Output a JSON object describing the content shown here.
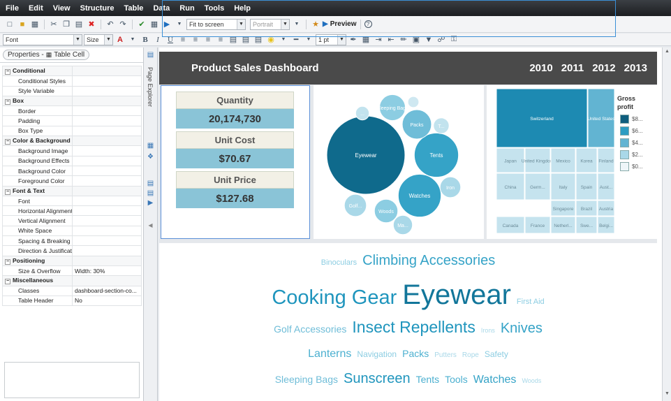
{
  "menu": [
    "File",
    "Edit",
    "View",
    "Structure",
    "Table",
    "Data",
    "Run",
    "Tools",
    "Help"
  ],
  "toolbar": {
    "zoom_value": "Fit to screen",
    "orientation_value": "Portrait",
    "preview_label": "Preview"
  },
  "format_bar": {
    "font_value": "Font",
    "size_value": "Size",
    "line_width_value": "1 pt"
  },
  "properties_panel": {
    "title": "Properties - ",
    "context": "Table Cell",
    "groups": [
      {
        "name": "Conditional",
        "rows": [
          {
            "name": "Conditional Styles",
            "value": ""
          },
          {
            "name": "Style Variable",
            "value": ""
          }
        ]
      },
      {
        "name": "Box",
        "rows": [
          {
            "name": "Border",
            "value": ""
          },
          {
            "name": "Padding",
            "value": ""
          },
          {
            "name": "Box Type",
            "value": ""
          }
        ]
      },
      {
        "name": "Color & Background",
        "rows": [
          {
            "name": "Background Image",
            "value": ""
          },
          {
            "name": "Background Effects",
            "value": ""
          },
          {
            "name": "Background Color",
            "value": ""
          },
          {
            "name": "Foreground Color",
            "value": ""
          }
        ]
      },
      {
        "name": "Font & Text",
        "rows": [
          {
            "name": "Font",
            "value": ""
          },
          {
            "name": "Horizontal Alignment",
            "value": ""
          },
          {
            "name": "Vertical Alignment",
            "value": ""
          },
          {
            "name": "White Space",
            "value": ""
          },
          {
            "name": "Spacing & Breaking",
            "value": ""
          },
          {
            "name": "Direction & Justification",
            "value": ""
          }
        ]
      },
      {
        "name": "Positioning",
        "rows": [
          {
            "name": "Size & Overflow",
            "value": "Width: 30%"
          }
        ]
      },
      {
        "name": "Miscellaneous",
        "rows": [
          {
            "name": "Classes",
            "value": "dashboard-section-co..."
          },
          {
            "name": "Table Header",
            "value": "No"
          }
        ]
      }
    ]
  },
  "side_strip": {
    "page_explorer_label": "Page Explorer"
  },
  "dashboard": {
    "title": "Product Sales Dashboard",
    "years": [
      "2010",
      "2011",
      "2012",
      "2013"
    ],
    "kpis": [
      {
        "label": "Quantity",
        "value": "20,174,730"
      },
      {
        "label": "Unit Cost",
        "value": "$70.67"
      },
      {
        "label": "Unit Price",
        "value": "$127.68"
      }
    ],
    "bubbles": [
      {
        "label": "Eyewear",
        "value": 100,
        "color": "#0f6a8c"
      },
      {
        "label": "Tents",
        "value": 32,
        "color": "#35a3c7"
      },
      {
        "label": "Watches",
        "value": 30,
        "color": "#35a3c7"
      },
      {
        "label": "Packs",
        "value": 14,
        "color": "#6fbdd8"
      },
      {
        "label": "Sleeping Bags",
        "value": 11,
        "color": "#8ccde2"
      },
      {
        "label": "Woods",
        "value": 9,
        "color": "#8ccde2"
      },
      {
        "label": "Golf...",
        "value": 8,
        "color": "#a9d8e8"
      },
      {
        "label": "Iron",
        "value": 7,
        "color": "#a9d8e8"
      },
      {
        "label": "Ma...",
        "value": 6,
        "color": "#a9d8e8"
      },
      {
        "label": "T...",
        "value": 4,
        "color": "#c2e3ee"
      },
      {
        "label": "...",
        "value": 3,
        "color": "#c2e3ee"
      },
      {
        "label": "...",
        "value": 2,
        "color": "#cfe8f1"
      }
    ],
    "treemap": {
      "legend_title": "Gross profit",
      "legend": [
        {
          "label": "$8...",
          "color": "#0f5e7e"
        },
        {
          "label": "$6...",
          "color": "#2c9cc2"
        },
        {
          "label": "$4...",
          "color": "#62b4d2"
        },
        {
          "label": "$2...",
          "color": "#a9d8e8"
        },
        {
          "label": "$0...",
          "color": "#eef6f9"
        }
      ],
      "cells": [
        {
          "label": "Switzerland",
          "color": "#1d8ab2"
        },
        {
          "label": "United States",
          "color": "#62b4d2"
        },
        {
          "label": "Japan",
          "color": "#c5e3ee"
        },
        {
          "label": "United Kingdom",
          "color": "#c5e3ee"
        },
        {
          "label": "Mexico",
          "color": "#c5e3ee"
        },
        {
          "label": "Korea",
          "color": "#c5e3ee"
        },
        {
          "label": "Finland",
          "color": "#c5e3ee"
        },
        {
          "label": "China",
          "color": "#c5e3ee"
        },
        {
          "label": "Germ...",
          "color": "#c5e3ee"
        },
        {
          "label": "Italy",
          "color": "#c5e3ee"
        },
        {
          "label": "Spain",
          "color": "#c5e3ee"
        },
        {
          "label": "Aust...",
          "color": "#c5e3ee"
        },
        {
          "label": "Singapore",
          "color": "#c5e3ee"
        },
        {
          "label": "Brazil",
          "color": "#c5e3ee"
        },
        {
          "label": "Austria",
          "color": "#c5e3ee"
        },
        {
          "label": "Canada",
          "color": "#c5e3ee"
        },
        {
          "label": "France",
          "color": "#c5e3ee"
        },
        {
          "label": "Netherl...",
          "color": "#c5e3ee"
        },
        {
          "label": "Swe...",
          "color": "#c5e3ee"
        },
        {
          "label": "Belgi...",
          "color": "#c5e3ee"
        }
      ]
    },
    "wordcloud": [
      [
        {
          "text": "Binoculars",
          "size": 11,
          "color": "#8ccde2"
        },
        {
          "text": "Climbing Accessories",
          "size": 20,
          "color": "#35a3c7"
        }
      ],
      [
        {
          "text": "Cooking Gear",
          "size": 29,
          "color": "#1f95bd"
        },
        {
          "text": "Eyewear",
          "size": 40,
          "color": "#12769a"
        },
        {
          "text": "First Aid",
          "size": 11,
          "color": "#8ccde2"
        }
      ],
      [
        {
          "text": "Golf Accessories",
          "size": 14,
          "color": "#6fbdd8"
        },
        {
          "text": "Insect Repellents",
          "size": 23,
          "color": "#1f95bd"
        },
        {
          "text": "Irons",
          "size": 9,
          "color": "#a9d8e8"
        },
        {
          "text": "Knives",
          "size": 20,
          "color": "#35a3c7"
        }
      ],
      [
        {
          "text": "Lanterns",
          "size": 16,
          "color": "#4cb0d0"
        },
        {
          "text": "Navigation",
          "size": 12,
          "color": "#8ccde2"
        },
        {
          "text": "Packs",
          "size": 14,
          "color": "#4cb0d0"
        },
        {
          "text": "Putters",
          "size": 10,
          "color": "#a9d8e8"
        },
        {
          "text": "Rope",
          "size": 10,
          "color": "#a9d8e8"
        },
        {
          "text": "Safety",
          "size": 12,
          "color": "#8ccde2"
        }
      ],
      [
        {
          "text": "Sleeping Bags",
          "size": 14,
          "color": "#6fbdd8"
        },
        {
          "text": "Sunscreen",
          "size": 20,
          "color": "#1f95bd"
        },
        {
          "text": "Tents",
          "size": 14,
          "color": "#4cb0d0"
        },
        {
          "text": "Tools",
          "size": 14,
          "color": "#4cb0d0"
        },
        {
          "text": "Watches",
          "size": 16,
          "color": "#35a3c7"
        },
        {
          "text": "Woods",
          "size": 9,
          "color": "#a9d8e8"
        }
      ]
    ]
  },
  "colors": {
    "header_bg": "#4a4a4a",
    "kpi_value_bg": "#8ac4d7",
    "kpi_label_bg": "#f2f0e6",
    "accent": "#3a8fd6"
  }
}
